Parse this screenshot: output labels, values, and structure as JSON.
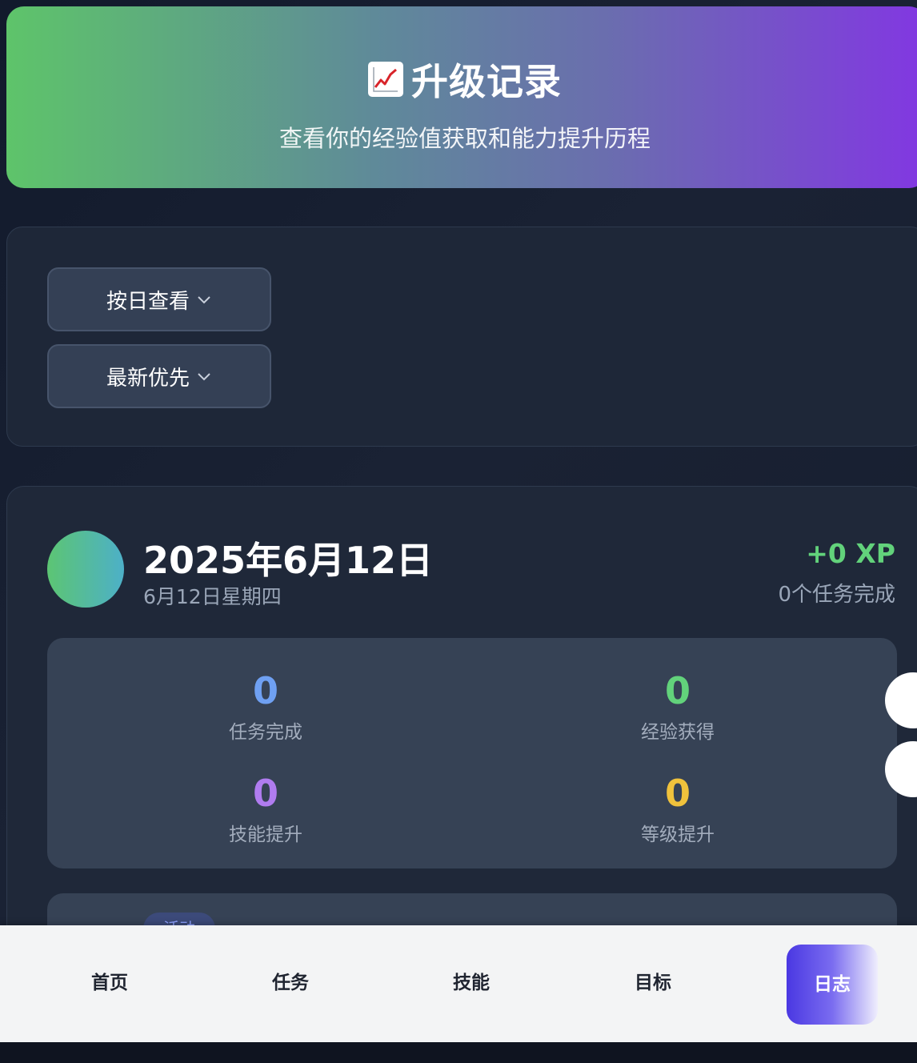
{
  "header": {
    "icon": "chart-increasing-icon",
    "title": "升级记录",
    "subtitle": "查看你的经验值获取和能力提升历程"
  },
  "filters": {
    "view_mode": "按日查看",
    "sort_order": "最新优先"
  },
  "day": {
    "date": "2025年6月12日",
    "weekday": "6月12日星期四",
    "xp": "+0 XP",
    "tasks_done": "0个任务完成",
    "stats": [
      {
        "value": "0",
        "label": "任务完成",
        "color": "#6fa0f2"
      },
      {
        "value": "0",
        "label": "经验获得",
        "color": "#62d27b"
      },
      {
        "value": "0",
        "label": "技能提升",
        "color": "#b07cf0"
      },
      {
        "value": "0",
        "label": "等级提升",
        "color": "#f0c23c"
      }
    ],
    "activity_tag": "活动"
  },
  "nav": {
    "items": [
      "首页",
      "任务",
      "技能",
      "目标",
      "日志"
    ],
    "active": "日志"
  },
  "colors": {
    "header_gradient": [
      "#5ec46a",
      "#8237e2"
    ],
    "accent": "#4a38e2",
    "background": "#1a2234"
  }
}
